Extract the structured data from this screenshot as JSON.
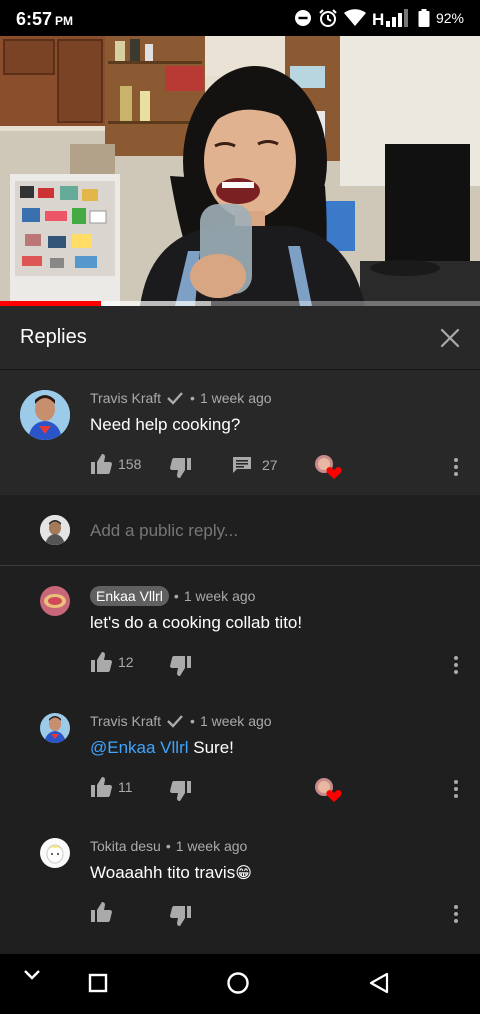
{
  "status_bar": {
    "time": "6:57",
    "ampm": "PM",
    "battery_percent": "92%"
  },
  "video": {
    "progress": 0.21,
    "buffered": 0.44
  },
  "replies_header": {
    "title": "Replies"
  },
  "parent_comment": {
    "author": "Travis Kraft",
    "time_ago": "1 week ago",
    "text": "Need help cooking?",
    "likes": "158",
    "reply_count": "27"
  },
  "add_reply": {
    "placeholder": "Add a public reply..."
  },
  "replies": [
    {
      "author": "Enkaa Vllrl",
      "time_ago": "1 week ago",
      "text": "let's do a cooking collab tito!",
      "likes": "12"
    },
    {
      "author": "Travis Kraft",
      "time_ago": "1 week ago",
      "mention": "@Enkaa Vllrl",
      "text": " Sure!",
      "likes": "11"
    },
    {
      "author": "Tokita desu",
      "time_ago": "1 week ago",
      "text": "Woaaahh tito travis",
      "emoji": "😁"
    }
  ],
  "colors": {
    "accent_red": "#ff0000",
    "mention_blue": "#3ea6ff",
    "heart_red": "#ff0000"
  },
  "icons": [
    "dnd-icon",
    "alarm-icon",
    "wifi-icon",
    "signal-icon",
    "battery-icon",
    "close-icon",
    "thumbs-up-icon",
    "thumbs-down-icon",
    "reply-icon",
    "more-vert-icon",
    "verified-check-icon",
    "creator-heart-icon",
    "back-icon",
    "home-icon",
    "recents-icon",
    "collapse-icon"
  ]
}
